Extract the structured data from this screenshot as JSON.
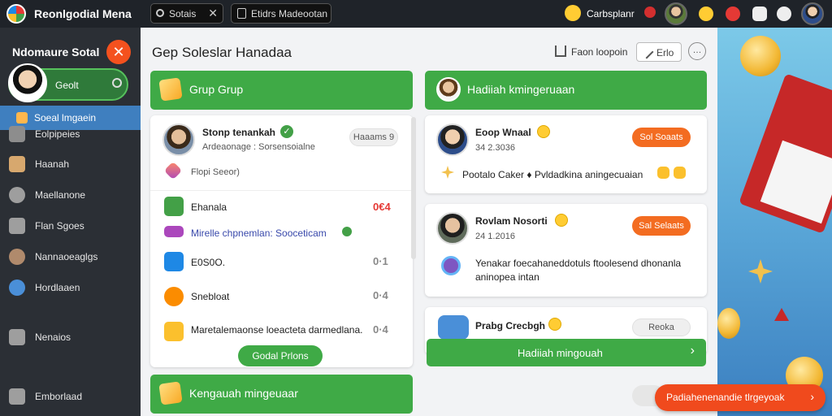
{
  "app": {
    "title": "Reonlgodial Mena"
  },
  "topbar": {
    "search_label": "Sotais",
    "search2_label": "Etidrs Madeootan",
    "user_label": "Carbsplanr"
  },
  "sidebar": {
    "header": "Ndomaure Sotal",
    "profile_name": "Geolt",
    "active_item": "Soeal lmgaein",
    "items": [
      {
        "label": "Eolpipeies",
        "icon": "wrench-icon",
        "color": "#9e9e9e"
      },
      {
        "label": "Haanah",
        "icon": "person-icon",
        "color": "#d7a86e"
      },
      {
        "label": "Maellanone",
        "icon": "search-icon",
        "color": "#9e9e9e"
      },
      {
        "label": "Flan Sgoes",
        "icon": "stack-icon",
        "color": "#9e9e9e"
      },
      {
        "label": "Nannaoeaglgs",
        "icon": "dog-icon",
        "color": "#b08a6c"
      },
      {
        "label": "Hordlaaen",
        "icon": "globe-icon",
        "color": "#4a8fd8"
      },
      {
        "label": "Nenaios",
        "icon": "bank-icon",
        "color": "#9e9e9e"
      },
      {
        "label": "Emborlaad",
        "icon": "home-icon",
        "color": "#9e9e9e"
      }
    ]
  },
  "main": {
    "title": "Gep Soleslar Hanadaa",
    "home_label": "Faon loopoin",
    "filter_label": "Erlo",
    "more_label": "…"
  },
  "left_panel": {
    "header": "Grup Grup",
    "profile": {
      "name": "Stonp tenankah",
      "subtitle": "Ardeaonage : Sorsensoialne",
      "badge": "Haaams 9",
      "tag": "Flopi Seeor)"
    },
    "rows": [
      {
        "label": "Ehanala",
        "value": "0€4",
        "icon": "leaf-icon",
        "color": "#43a047"
      },
      {
        "label": "Mirelle chpnemlan: Sooceticam",
        "value": "",
        "icon": "palette-icon",
        "color": "#ab47bc"
      },
      {
        "label": "E0S0O.",
        "value": "0·1",
        "icon": "box-icon",
        "color": "#1e88e5"
      },
      {
        "label": "Snebloat",
        "value": "0·4",
        "icon": "coin-icon",
        "color": "#fb8c00"
      },
      {
        "label": "Maretalemaonse loeacteta darmedlana.",
        "value": "0·4",
        "icon": "gift-icon",
        "color": "#fbc02d"
      }
    ],
    "action_button": "Godal Prlons",
    "footer_header": "Kengauah mingeuaar"
  },
  "right_panel": {
    "header": "Hadiiah kmingeruaan",
    "entries": [
      {
        "name": "Eoop Wnaal",
        "date": "34 2.3036",
        "button": "Sol Soaats",
        "line": "Pootalo  Caker ♦ Pvldadkina aningecuaian"
      },
      {
        "name": "Rovlam Nosorti",
        "date": "24 1.2016",
        "button": "Sal Selaats",
        "line": "Yenakar foecahaneddotuls ftoolesend dhonanla",
        "line2": "aninopea intan"
      },
      {
        "name": "Prabg Crecbgh",
        "badge": "Reoka"
      }
    ],
    "action_button": "Hadiiah mingouah"
  },
  "cta": {
    "label": "Padiahenenandie tlrgeyoak",
    "color": "#f04a1d"
  },
  "colors": {
    "green": "#3faa46",
    "orange": "#f36c21",
    "sidebar": "#2b2f35",
    "topbar": "#1f2329"
  }
}
